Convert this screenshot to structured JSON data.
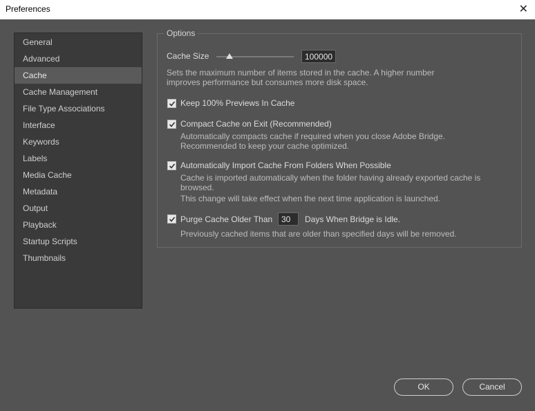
{
  "window": {
    "title": "Preferences",
    "close_icon": "close-icon"
  },
  "sidebar": {
    "items": [
      {
        "label": "General"
      },
      {
        "label": "Advanced"
      },
      {
        "label": "Cache",
        "selected": true
      },
      {
        "label": "Cache Management"
      },
      {
        "label": "File Type Associations"
      },
      {
        "label": "Interface"
      },
      {
        "label": "Keywords"
      },
      {
        "label": "Labels"
      },
      {
        "label": "Media Cache"
      },
      {
        "label": "Metadata"
      },
      {
        "label": "Output"
      },
      {
        "label": "Playback"
      },
      {
        "label": "Startup Scripts"
      },
      {
        "label": "Thumbnails"
      }
    ]
  },
  "options": {
    "group_label": "Options",
    "cache_size": {
      "label": "Cache Size",
      "value": "100000",
      "slider_level": 0.17,
      "description_line1": "Sets the maximum number of items stored in the cache. A higher number",
      "description_line2": "improves performance but consumes more disk space."
    },
    "keep_previews": {
      "label": "Keep 100% Previews In Cache",
      "checked": true
    },
    "compact_cache": {
      "label": "Compact Cache on Exit (Recommended)",
      "checked": true,
      "description_line1": "Automatically compacts cache if required when you close Adobe Bridge.",
      "description_line2": "Recommended to keep your cache optimized."
    },
    "auto_import": {
      "label": "Automatically Import Cache From Folders When Possible",
      "checked": true,
      "description_line1": "Cache is imported automatically when the folder having already exported cache is",
      "description_line2": "browsed.",
      "description_line3": "This change will take effect when the next time application is launched."
    },
    "purge_cache": {
      "label_before": "Purge Cache Older Than",
      "days": "30",
      "label_after": "Days When Bridge is Idle.",
      "checked": true,
      "description": "Previously cached items that are older than specified days will be removed."
    }
  },
  "buttons": {
    "ok": "OK",
    "cancel": "Cancel"
  }
}
